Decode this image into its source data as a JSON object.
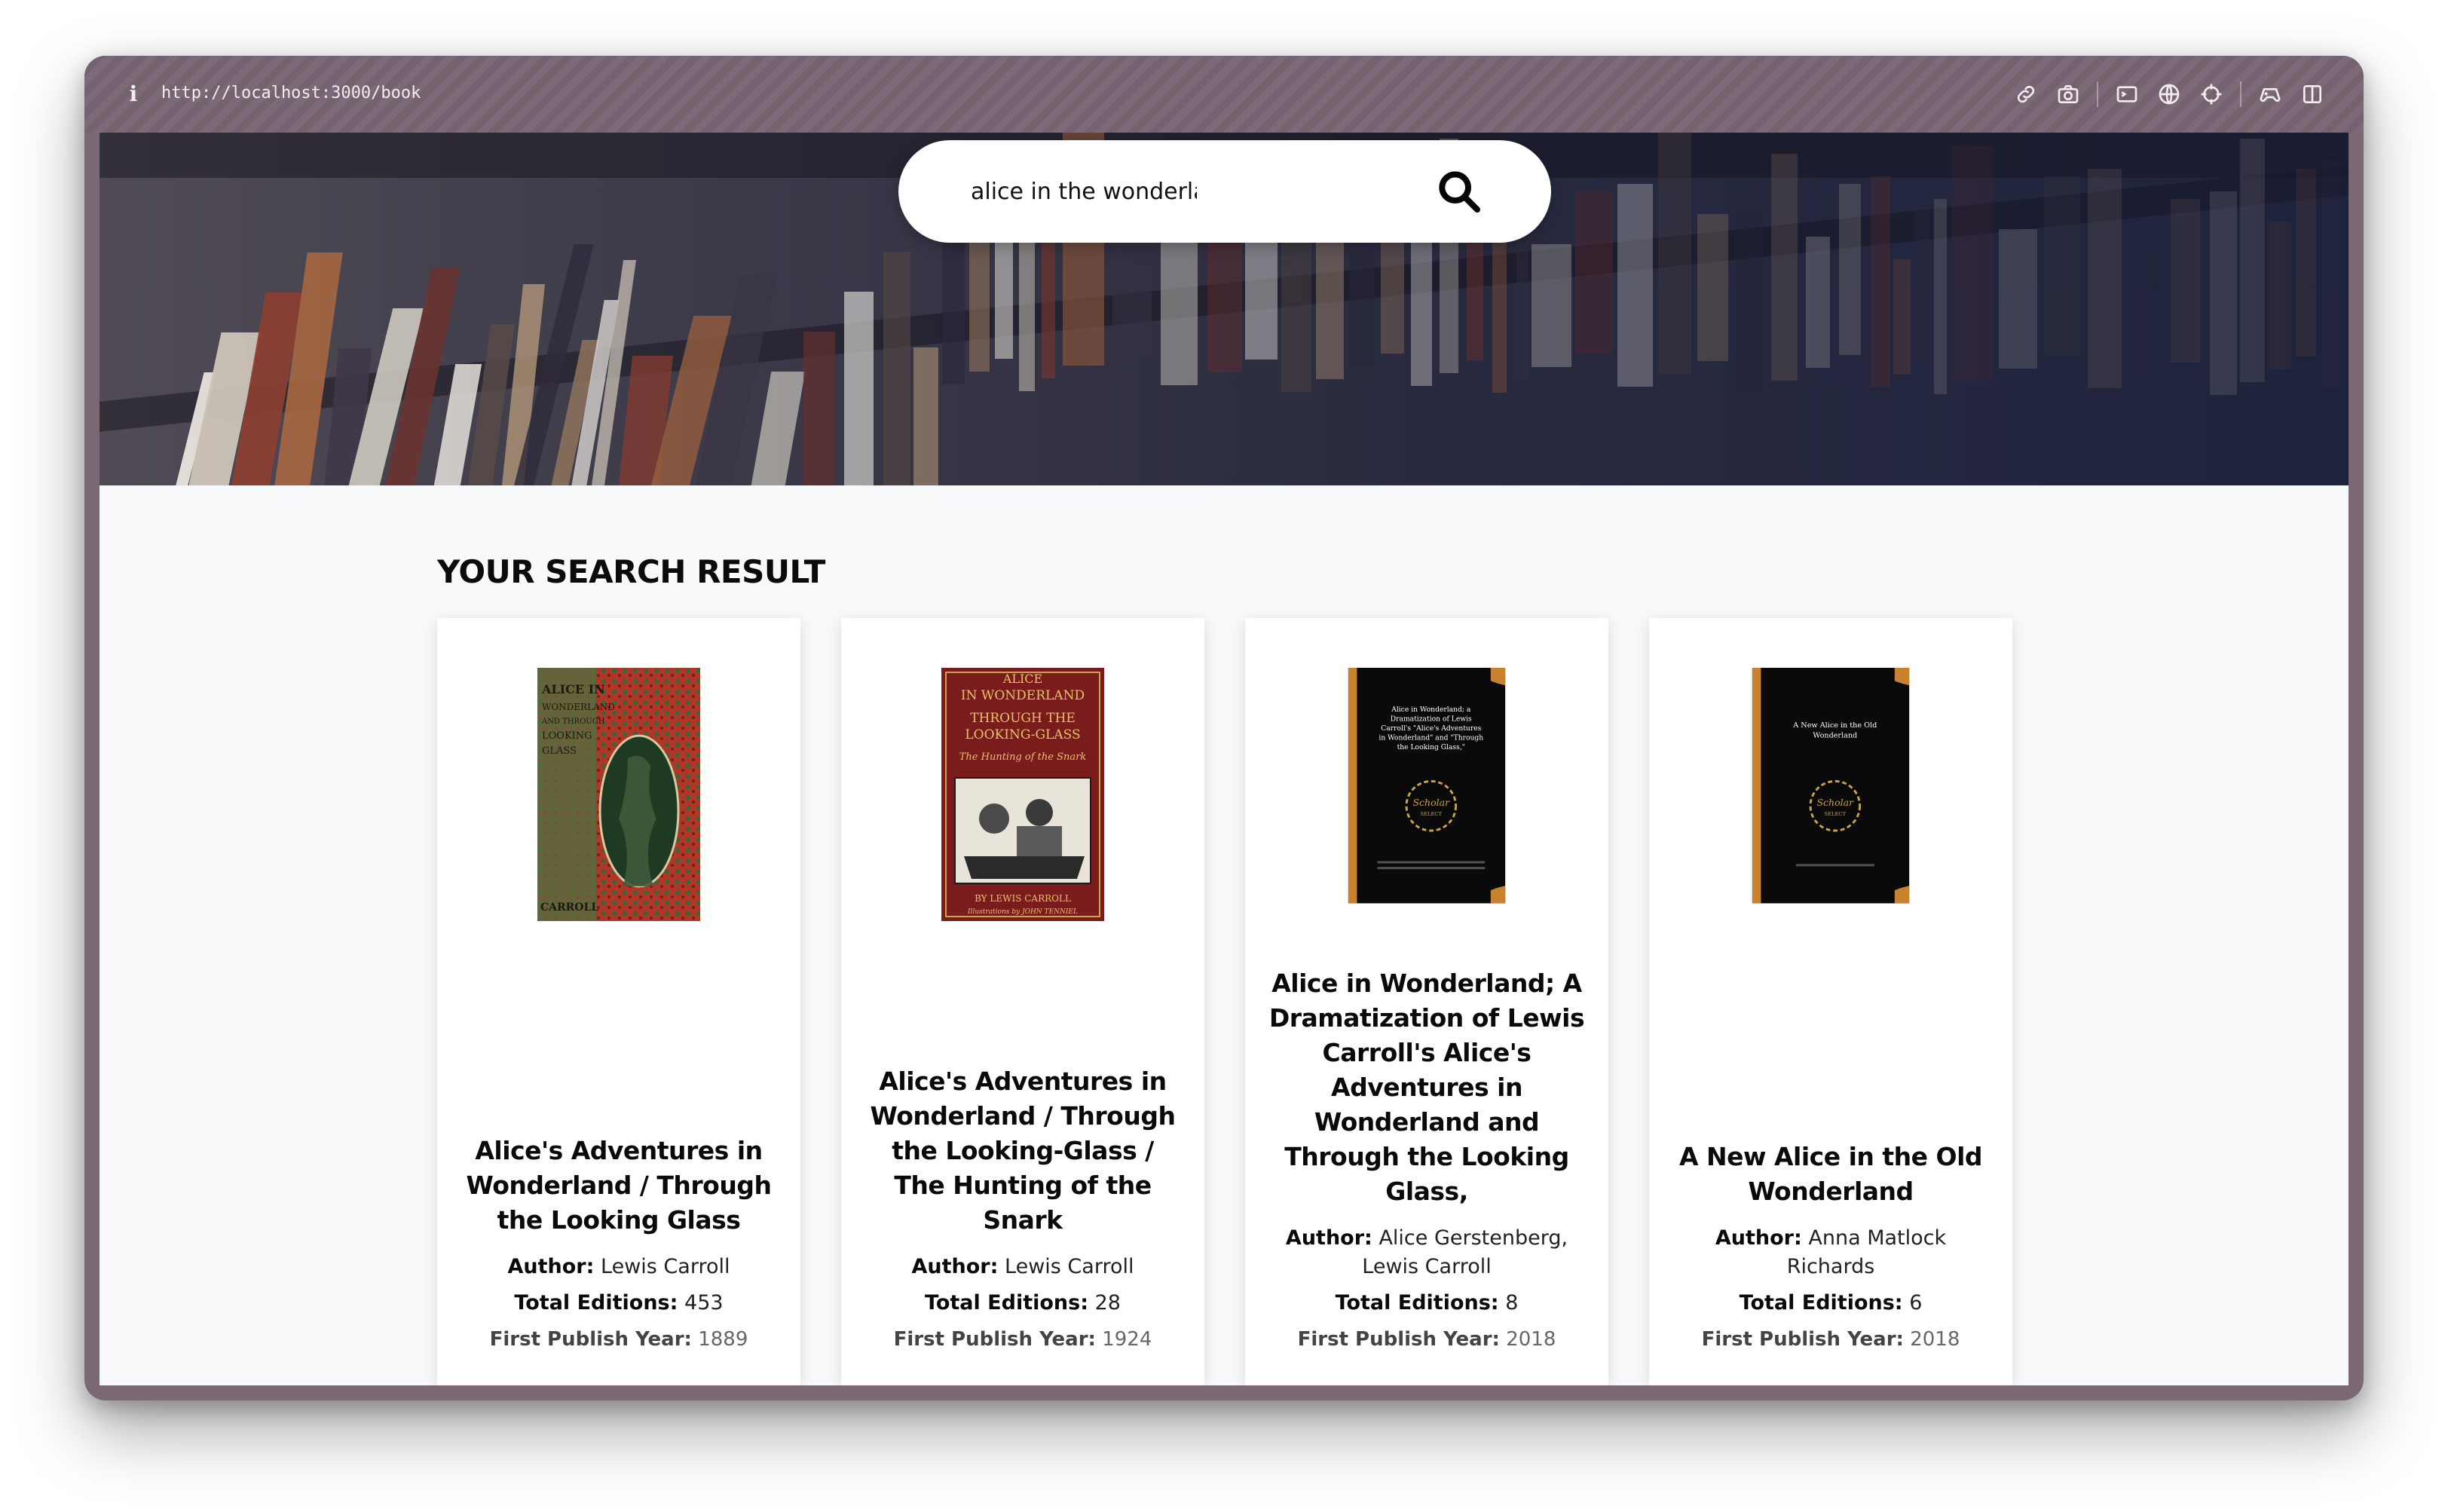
{
  "browser": {
    "url": "http://localhost:3000/book",
    "toolbar_icons": [
      "link-icon",
      "camera-icon",
      "terminal-icon",
      "globe-icon",
      "crosshair-icon",
      "gamepad-icon",
      "split-view-icon"
    ]
  },
  "search": {
    "value": "alice in the wonderla",
    "icon": "search-icon"
  },
  "results": {
    "heading": "YOUR SEARCH RESULT",
    "author_label": "Author:",
    "editions_label": "Total Editions:",
    "year_label": "First Publish Year:",
    "books": [
      {
        "title": "Alice's Adventures in Wonderland / Through the Looking Glass",
        "author": "Lewis Carroll",
        "editions": "453",
        "first_publish_year": "1889",
        "cover_text": "ALICE IN WONDERLAND AND THROUGH THE LOOKING GLASS CARROLL"
      },
      {
        "title": "Alice's Adventures in Wonderland / Through the Looking-Glass / The Hunting of the Snark",
        "author": "Lewis Carroll",
        "editions": "28",
        "first_publish_year": "1924",
        "cover_text": "ALICE IN WONDERLAND THROUGH THE LOOKING-GLASS The Hunting of the Snark BY LEWIS CARROLL Illustrations by JOHN TENNIEL"
      },
      {
        "title": "Alice in Wonderland; A Dramatization of Lewis Carroll's Alice's Adventures in Wonderland and Through the Looking Glass,",
        "author": "Alice Gerstenberg, Lewis Carroll",
        "editions": "8",
        "first_publish_year": "2018",
        "cover_text": "Alice in Wonderland; a Dramatization of Lewis Carroll's \"Alice's Adventures in Wonderland\" and \"Through the Looking Glass,\""
      },
      {
        "title": "A New Alice in the Old Wonderland",
        "author": "Anna Matlock Richards",
        "editions": "6",
        "first_publish_year": "2018",
        "cover_text": "A New Alice in the Old Wonderland"
      }
    ],
    "seal_text": "Scholar Select"
  }
}
